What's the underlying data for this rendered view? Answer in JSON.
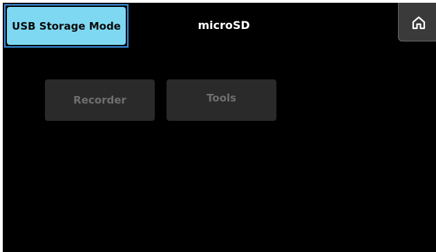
{
  "header": {
    "usb_button_label": "USB Storage Mode",
    "title": "microSD",
    "home_icon": "home-icon"
  },
  "menu": {
    "items": [
      {
        "label": "Recorder",
        "enabled": false
      },
      {
        "label": "Tools",
        "enabled": false
      }
    ]
  },
  "colors": {
    "background": "#000000",
    "usb_button": "#7fd8f2",
    "usb_outline": "#3a8fe0",
    "disabled_button": "#2a2a2a",
    "disabled_text": "#6f6f6f",
    "home_button": "#3a3a3a"
  }
}
